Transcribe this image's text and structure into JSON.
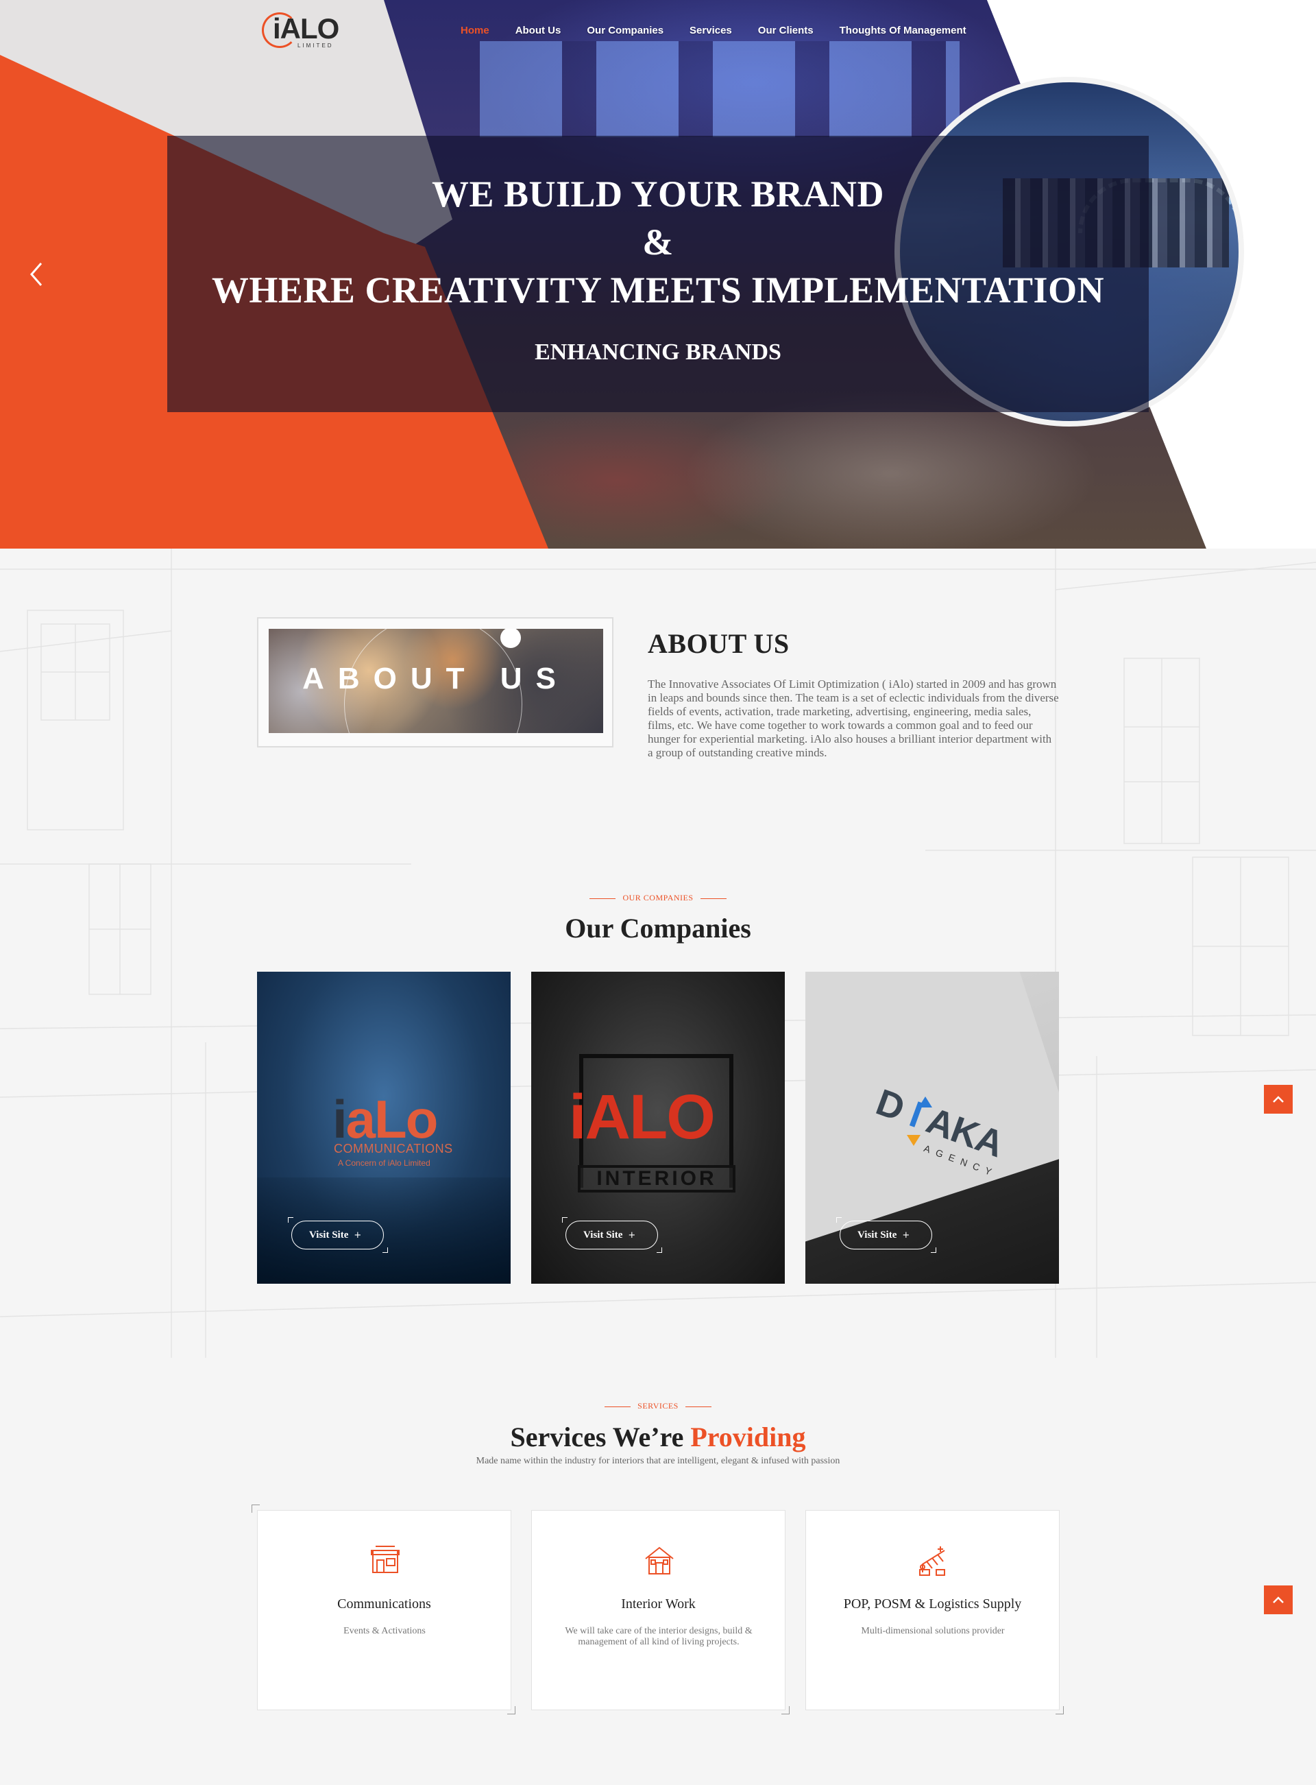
{
  "nav": {
    "logo_text": "iALO",
    "logo_sub": "LIMITED",
    "items": [
      "Home",
      "About Us",
      "Our Companies",
      "Services",
      "Our Clients",
      "Thoughts Of Management"
    ],
    "active_item": "Home"
  },
  "hero": {
    "line1": "WE BUILD YOUR BRAND",
    "line2": "&",
    "line3": "WHERE CREATIVITY MEETS IMPLEMENTATION",
    "subtitle": "ENHANCING BRANDS",
    "prev_icon": "chevron-left-icon"
  },
  "about": {
    "image_text": "ABOUT US",
    "title": "ABOUT US",
    "text": "The Innovative Associates Of Limit Optimization ( iAlo) started in 2009 and has grown in leaps and bounds since then. The team is a set of eclectic individuals from the diverse fields of events, activation, trade marketing, advertising, engineering, media sales, films, etc. We have come together to work towards a common goal and to feed our hunger for experiential marketing. iAlo also houses a brilliant interior department with a group of outstanding creative minds."
  },
  "companies": {
    "eyebrow": "OUR COMPANIES",
    "title": "Our Companies",
    "cards": [
      {
        "logo_i": "i",
        "logo_rest": "aLo",
        "sub": "COMMUNICATIONS",
        "sub2": "A Concern of iAlo Limited",
        "button": "Visit Site"
      },
      {
        "logo": "iALO",
        "sub": "INTERIOR",
        "button": "Visit Site"
      },
      {
        "logo_a": "D",
        "logo_b": "I",
        "logo_c": "AKA",
        "sub": "AGENCY",
        "button": "Visit Site"
      }
    ],
    "plus": "+"
  },
  "services": {
    "eyebrow": "SERVICES",
    "title_main": "Services We’re ",
    "title_accent": "Providing",
    "description": "Made name within the industry for interiors that are intelligent, elegant & infused with passion",
    "cards": [
      {
        "title": "Communications",
        "text": "Events & Activations",
        "icon": "storefront-icon"
      },
      {
        "title": "Interior Work",
        "text": "We will take care of the interior designs, build & management of all kind of living projects.",
        "icon": "house-icon"
      },
      {
        "title": "POP, POSM & Logistics Supply",
        "text": "Multi-dimensional solutions provider",
        "icon": "shelf-supply-icon"
      }
    ]
  },
  "scroll_top_icon": "^",
  "colors": {
    "accent": "#ec5126",
    "dark": "#222222",
    "background": "#f5f5f5"
  }
}
